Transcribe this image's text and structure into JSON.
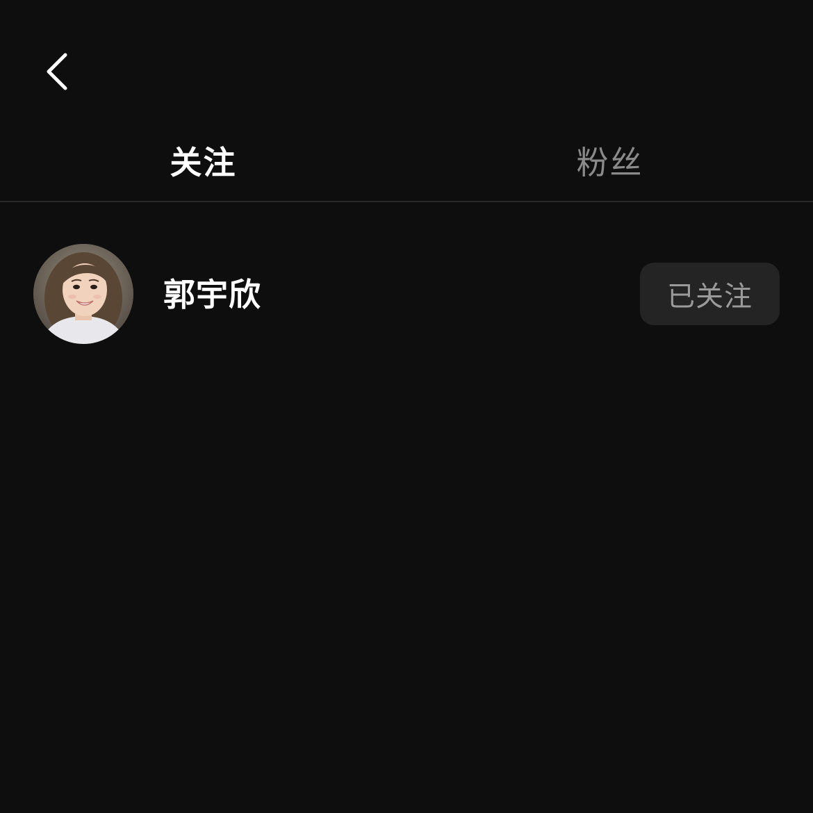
{
  "header": {
    "back_icon": "chevron-left-icon"
  },
  "tabs": [
    {
      "label": "关注",
      "active": true
    },
    {
      "label": "粉丝",
      "active": false
    }
  ],
  "following_list": [
    {
      "name": "郭宇欣",
      "button_label": "已关注",
      "avatar_icon": "user-avatar"
    }
  ],
  "colors": {
    "background": "#0e0e0e",
    "active_tab": "#ffffff",
    "inactive_tab": "#8a8a8a",
    "divider": "#2a2a2a",
    "button_bg": "#242424",
    "button_text": "#9a9a9a"
  }
}
